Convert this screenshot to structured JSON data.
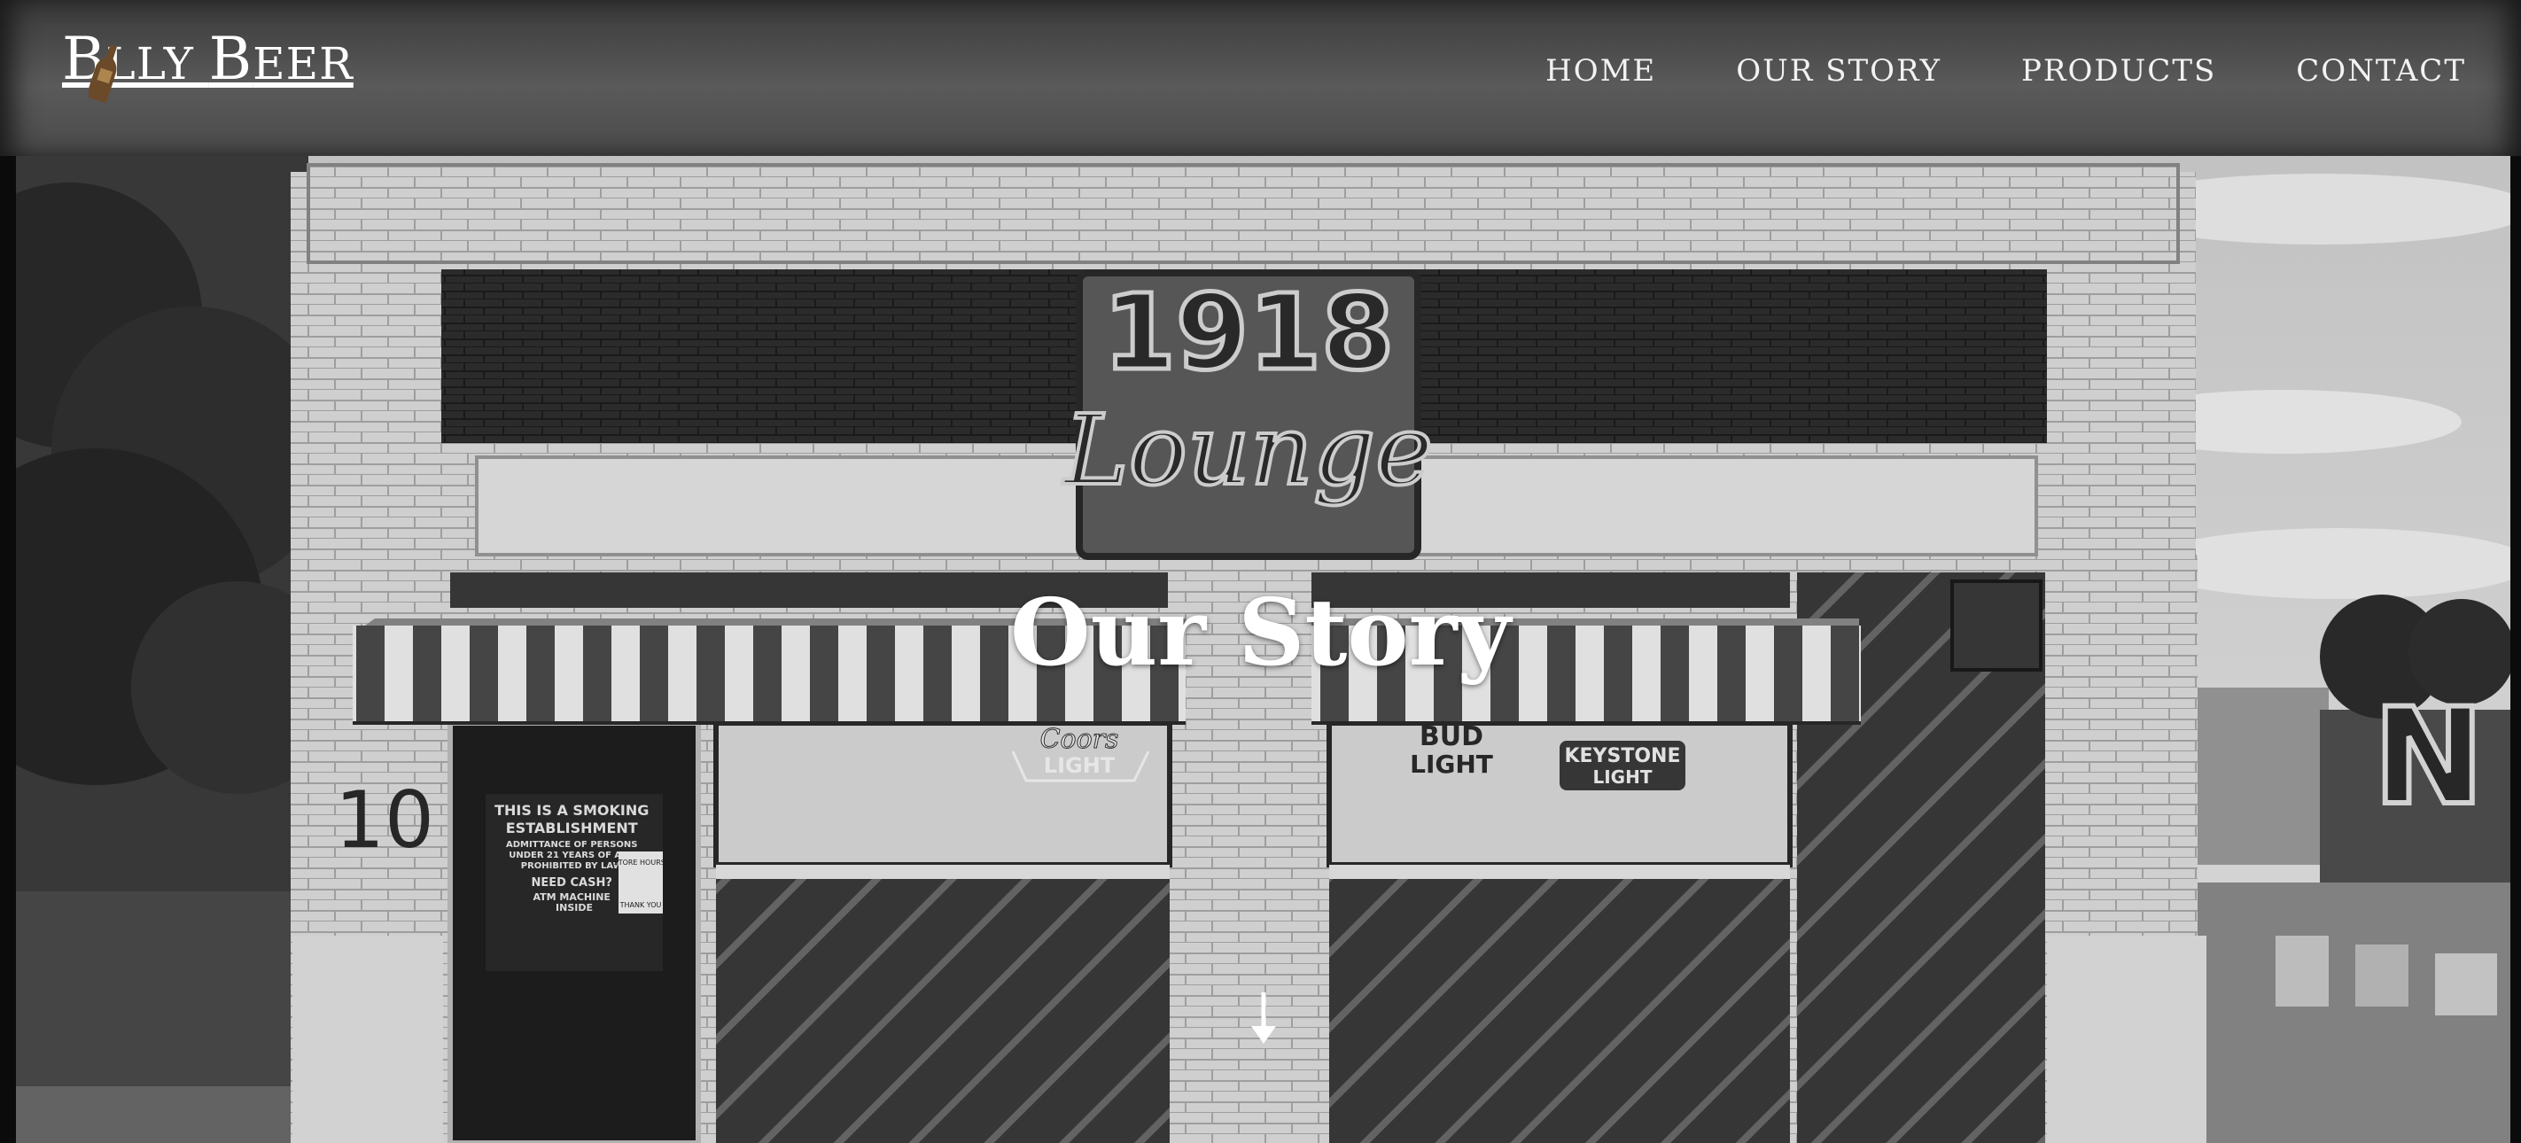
{
  "brand": {
    "name_first": "B",
    "name_rest": "LLY ",
    "name_second": "B",
    "name_rest2": "EER",
    "aria": "Billy Beer"
  },
  "nav": [
    {
      "label": "HOME"
    },
    {
      "label": "OUR STORY"
    },
    {
      "label": "PRODUCTS"
    },
    {
      "label": "CONTACT"
    }
  ],
  "hero": {
    "title": "Our Story",
    "scroll_icon": "arrow-down-icon"
  },
  "photo": {
    "sign_year": "1918",
    "sign_word": "Lounge",
    "street_number": "10",
    "door_notice": [
      "THIS IS A SMOKING",
      "ESTABLISHMENT",
      "ADMITTANCE OF PERSONS",
      "UNDER 21 YEARS OF AGE",
      "PROHIBITED BY LAW",
      "NEED CASH?",
      "ATM MACHINE",
      "INSIDE"
    ],
    "door_small_sign": [
      "STORE HOURS",
      "THANK YOU"
    ],
    "neon_coors_1": "Coors",
    "neon_coors_2": "LIGHT",
    "neon_bud_1": "BUD",
    "neon_bud_2": "LIGHT",
    "neon_keystone_1": "KEYSTONE",
    "neon_keystone_2": "LIGHT",
    "mural_letter": "N"
  },
  "colors": {
    "header": "#4a4a4a",
    "text": "#ffffff"
  }
}
